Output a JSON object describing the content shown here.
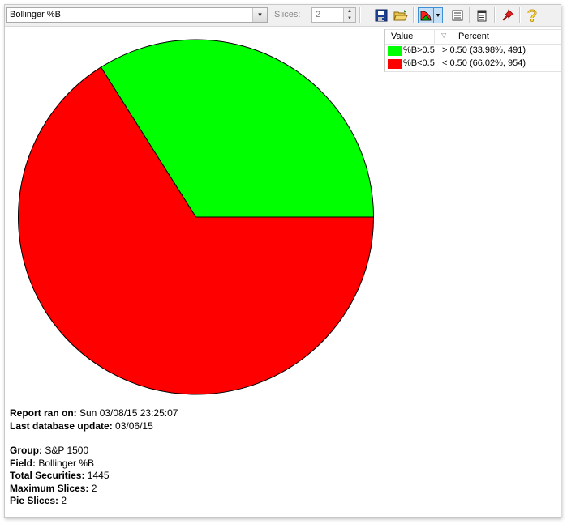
{
  "toolbar": {
    "field_select": "Bollinger %B",
    "slices_label": "Slices:",
    "slices_value": "2",
    "icons": [
      "save-icon",
      "open-folder-icon",
      "pie-chart-icon",
      "chevron-down-icon",
      "list-icon",
      "report-icon",
      "pin-icon",
      "help-icon"
    ]
  },
  "legend": {
    "col_value": "Value",
    "col_percent": "Percent",
    "rows": [
      {
        "value": "%B>0.5",
        "percent": "> 0.50 (33.98%, 491)",
        "color": "#00ff00"
      },
      {
        "value": "%B<0.5",
        "percent": "< 0.50 (66.02%, 954)",
        "color": "#ff0000"
      }
    ]
  },
  "chart_data": {
    "type": "pie",
    "slices": [
      {
        "label": "%B>0.5",
        "value": 491,
        "percent": 33.98,
        "color": "#00ff00"
      },
      {
        "label": "%B<0.5",
        "value": 954,
        "percent": 66.02,
        "color": "#ff0000"
      }
    ]
  },
  "report": {
    "ran_label": "Report ran on:",
    "ran_value": " Sun 03/08/15 23:25:07",
    "db_label": "Last database update:",
    "db_value": " 03/06/15",
    "group_label": "Group:",
    "group_value": " S&P 1500",
    "field_label": "Field:",
    "field_value": " Bollinger %B",
    "total_label": "Total Securities:",
    "total_value": " 1445",
    "max_label": "Maximum Slices:",
    "max_value": " 2",
    "pie_label": "Pie Slices:",
    "pie_value": " 2"
  }
}
